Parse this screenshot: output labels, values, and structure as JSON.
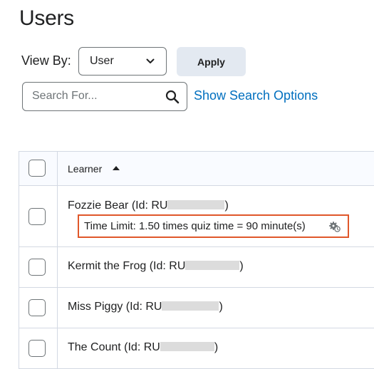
{
  "page": {
    "title": "Users"
  },
  "filter": {
    "view_by_label": "View By:",
    "view_by_value": "User",
    "apply_label": "Apply"
  },
  "search": {
    "placeholder": "Search For...",
    "show_options_label": "Show Search Options"
  },
  "table": {
    "learner_header": "Learner",
    "sort": "ascending",
    "rows": [
      {
        "name": "Fozzie Bear (Id: RU",
        "name_end": ")",
        "time_limit": "Time Limit: 1.50 times quiz time = 90 minute(s)"
      },
      {
        "name": "Kermit the Frog (Id: RU",
        "name_end": ")"
      },
      {
        "name": "Miss Piggy (Id: RU",
        "name_end": ")"
      },
      {
        "name": "The Count (Id: RU",
        "name_end": ")"
      }
    ]
  },
  "colors": {
    "link": "#006fbf",
    "highlight_border": "#e0572a",
    "apply_bg": "#e3e9f1"
  }
}
